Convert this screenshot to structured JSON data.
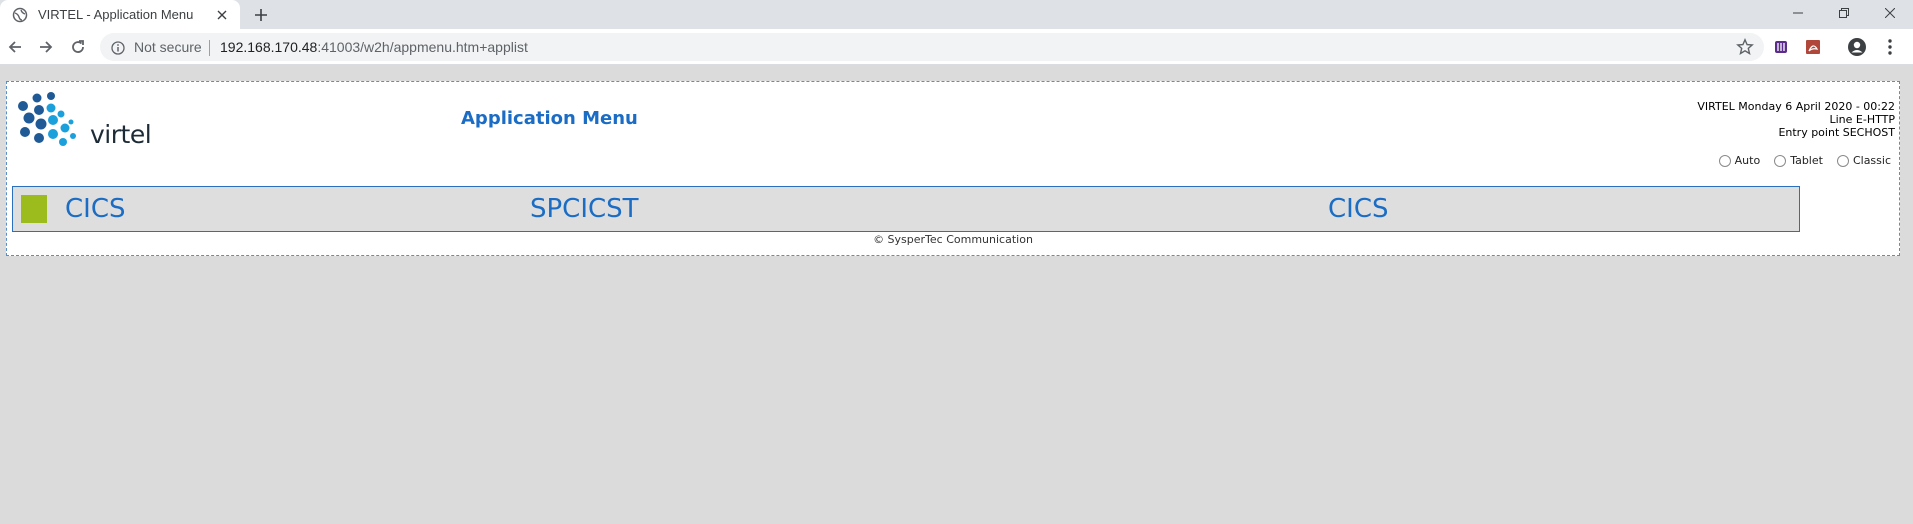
{
  "browser": {
    "tab_title": "VIRTEL - Application Menu",
    "security_label": "Not secure",
    "url_host": "192.168.170.48",
    "url_rest": ":41003/w2h/appmenu.htm+applist"
  },
  "page": {
    "logo_text": "virtel",
    "title": "Application Menu",
    "info_line1": "VIRTEL Monday 6 April 2020 - 00:22",
    "info_line2": "Line E-HTTP",
    "info_line3": "Entry point SECHOST",
    "modes": [
      "Auto",
      "Tablet",
      "Classic"
    ],
    "apps": {
      "col1": "CICS",
      "col2": "SPCICST",
      "col3": "CICS"
    },
    "footer": "© SysperTec Communication"
  },
  "colors": {
    "accent": "#1a6cc4",
    "app_square": "#9cbb1c",
    "row_bg": "#dedede"
  }
}
